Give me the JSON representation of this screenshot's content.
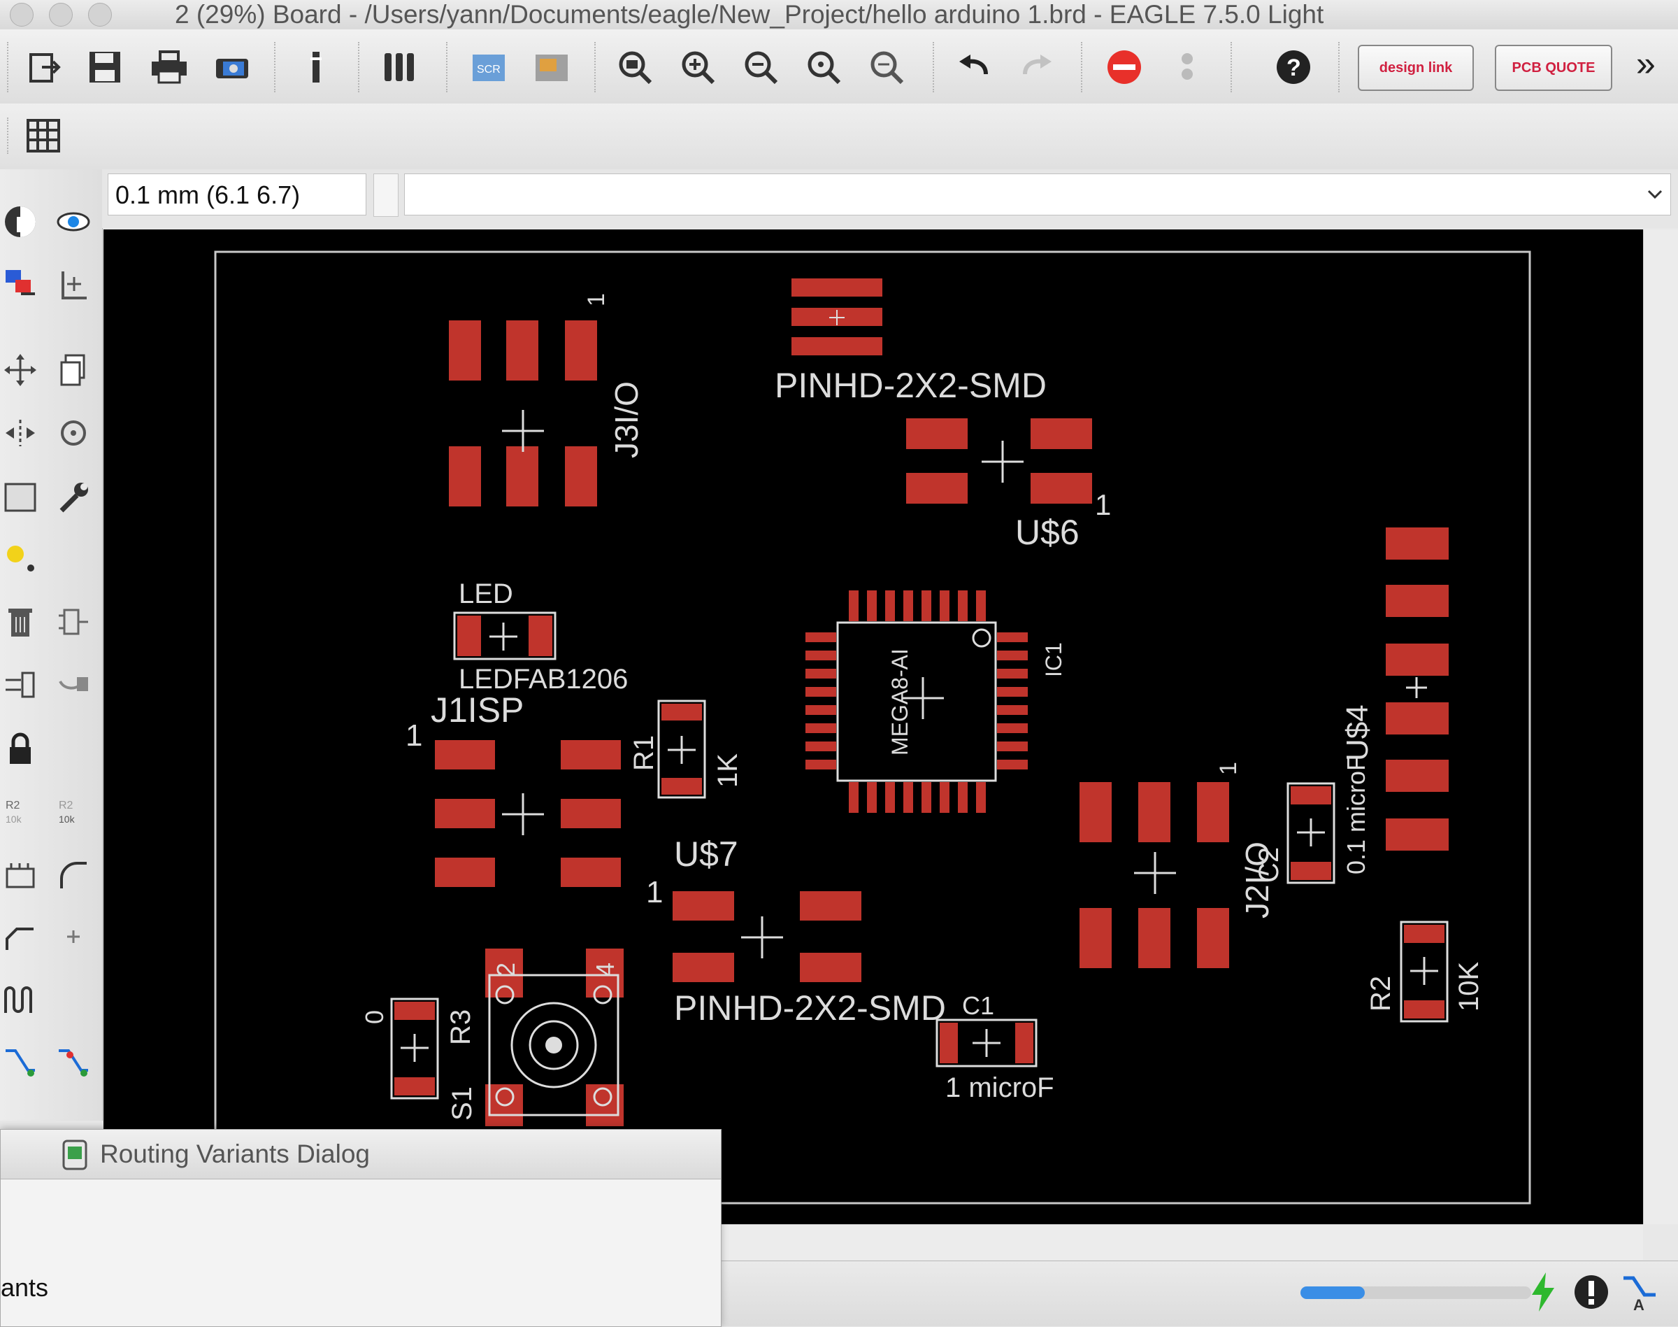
{
  "window": {
    "title": "2 (29%) Board - /Users/yann/Documents/eagle/New_Project/hello arduino 1.brd - EAGLE 7.5.0 Light"
  },
  "toolbar": {
    "items": [
      "open-icon",
      "save-icon",
      "print-icon",
      "cam-icon",
      "script-icon",
      "layer-icon",
      "scr-icon",
      "ulp-icon",
      "zoom-fit-icon",
      "zoom-in-icon",
      "zoom-out-icon",
      "zoom-select-icon",
      "zoom-redraw-icon",
      "undo-icon",
      "redo-icon",
      "stop-icon",
      "go-icon",
      "help-icon"
    ],
    "design_link_label": "design link",
    "pcb_quote_label": "PCB QUOTE",
    "overflow_label": "»"
  },
  "grid_button": "grid-icon",
  "command_bar": {
    "coordinate": "0.1 mm (6.1 6.7)",
    "command_value": ""
  },
  "board": {
    "labels": {
      "j3io": "J3I/O",
      "j3io_pin": "1",
      "pinhd_top": "PINHD-2X2-SMD",
      "us6": "U$6",
      "us6_pin": "1",
      "led": "LED",
      "ledfab": "LEDFAB1206",
      "j1isp": "J1ISP",
      "j1isp_pin": "1",
      "r1": "R1",
      "r1_val": "1K",
      "ic1": "IC1",
      "mega": "MEGA8-AI",
      "j2io": "J2I/O",
      "j2io_pin": "1",
      "c2": "C2",
      "c2_val": "0.1 microF",
      "us4": "U$4",
      "us7": "U$7",
      "us7_pin": "1",
      "pinhd_bottom": "PINHD-2X2-SMD",
      "c1": "C1",
      "c1_val": "1 microF",
      "r2": "R2",
      "r2_val": "10K",
      "r3": "R3",
      "r3_val": "0",
      "s1": "S1",
      "s1_pin2": "2",
      "s1_pin4": "4"
    }
  },
  "dialog": {
    "title": "Routing Variants Dialog",
    "partial_label": "ants"
  },
  "status": {
    "progress": 0.28
  },
  "colors": {
    "pad": "#c0342c",
    "silk": "#dcdcdc",
    "board_bg": "#000000",
    "accent": "#3a8ee6"
  }
}
